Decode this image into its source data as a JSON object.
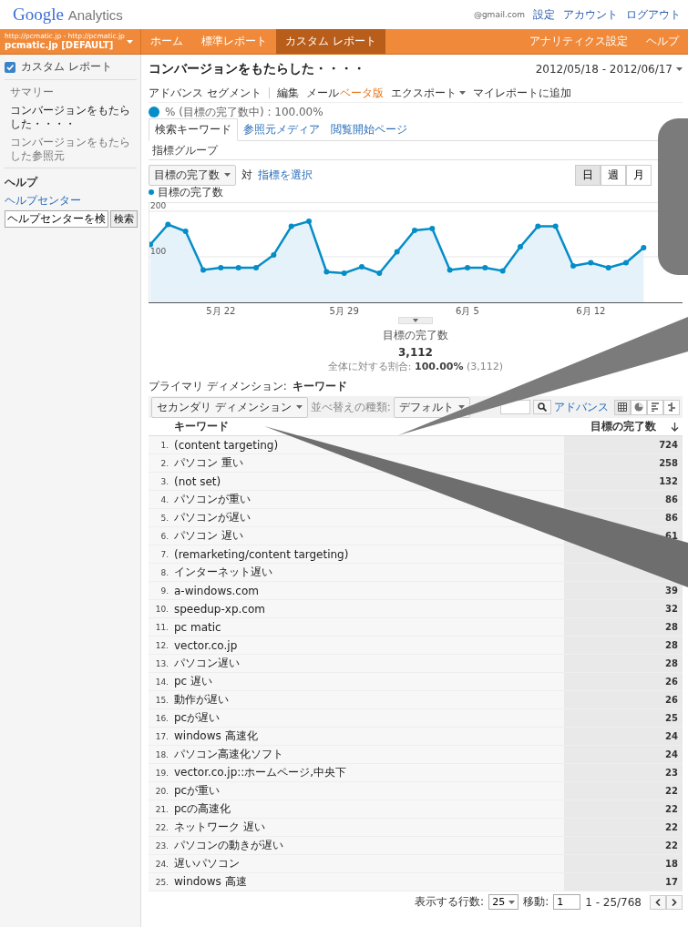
{
  "header": {
    "logo_google": "Google",
    "logo_product": "Analytics",
    "account": "@gmail.com",
    "links": [
      "設定",
      "アカウント",
      "ログアウト"
    ]
  },
  "nav": {
    "profile_url": "http://pcmatic.jp - http://pcmatic.jp",
    "profile_name": "pcmatic.jp [DEFAULT]",
    "tabs": [
      {
        "label": "ホーム",
        "selected": false
      },
      {
        "label": "標準レポート",
        "selected": false
      },
      {
        "label": "カスタム レポート",
        "selected": true
      }
    ],
    "right_tabs": [
      "アナリティクス設定",
      "ヘルプ"
    ]
  },
  "sidebar": {
    "section": "カスタム レポート",
    "items": [
      {
        "label": "サマリー",
        "selected": false
      },
      {
        "label": "コンバージョンをもたらした・・・・",
        "selected": true
      },
      {
        "label": "コンバージョンをもたらした参照元",
        "selected": false
      }
    ],
    "help_title": "ヘルプ",
    "help_link": "ヘルプセンター",
    "search_value": "ヘルプセンターを検",
    "search_button": "検索"
  },
  "report": {
    "title": "コンバージョンをもたらした・・・・",
    "date_range": "2012/05/18 - 2012/06/17",
    "toolbar": [
      {
        "label": "アドバンス セグメント",
        "kind": "text"
      },
      {
        "label": "編集",
        "kind": "text"
      },
      {
        "label": "メール",
        "kind": "text",
        "badge": "ベータ版"
      },
      {
        "label": "エクスポート",
        "kind": "menu"
      },
      {
        "label": "マイレポートに追加",
        "kind": "text"
      }
    ],
    "segment": "% (目標の完了数中) : 100.00%",
    "tabs": [
      {
        "label": "検索キーワード",
        "selected": true
      },
      {
        "label": "参照元メディア",
        "selected": false
      },
      {
        "label": "閲覧開始ページ",
        "selected": false
      }
    ],
    "subtab": "指標グループ",
    "metric_select": "目標の完了数",
    "versus": "対",
    "pick_metric": "指標を選択",
    "granularity": [
      {
        "label": "日",
        "selected": true
      },
      {
        "label": "週",
        "selected": false
      },
      {
        "label": "月",
        "selected": false
      }
    ],
    "chart_data": {
      "type": "area",
      "series": [
        {
          "name": "目標の完了数",
          "color": "#058dc7",
          "values": [
            127,
            171,
            156,
            71,
            76,
            76,
            76,
            104,
            167,
            178,
            67,
            64,
            78,
            64,
            111,
            158,
            162,
            71,
            76,
            76,
            69,
            122,
            167,
            167,
            80,
            87,
            76,
            87,
            120,
            null,
            null
          ]
        }
      ],
      "categories": [
        null,
        null,
        null,
        null,
        "5月 22",
        null,
        null,
        null,
        null,
        null,
        null,
        "5月 29",
        null,
        null,
        null,
        null,
        null,
        null,
        "6月 5",
        null,
        null,
        null,
        null,
        null,
        null,
        "6月 12",
        null,
        null,
        null,
        null,
        null
      ],
      "yticks": [
        100,
        200
      ],
      "ylim": [
        0,
        220
      ]
    },
    "summary": {
      "label": "目標の完了数",
      "value": "3,112",
      "share": "全体に対する割合: **100.00%** (3,112)"
    },
    "primary_label": "プライマリ ディメンション:",
    "primary_value": "キーワード",
    "secondary": "セカンダリ ディメンション",
    "sort_label": "並べ替えの種類:",
    "sort_value": "デフォルト",
    "advanced": "アドバンス",
    "columns": [
      "キーワード",
      "目標の完了数"
    ],
    "rows": [
      {
        "index": "1.",
        "keyword": "(content targeting)",
        "value": "724"
      },
      {
        "index": "2.",
        "keyword": "パソコン 重い",
        "value": "258"
      },
      {
        "index": "3.",
        "keyword": "(not set)",
        "value": "132"
      },
      {
        "index": "4.",
        "keyword": "パソコンが重い",
        "value": "86"
      },
      {
        "index": "5.",
        "keyword": "パソコンが遅い",
        "value": "86"
      },
      {
        "index": "6.",
        "keyword": "パソコン 遅い",
        "value": "61"
      },
      {
        "index": "7.",
        "keyword": "(remarketing/content targeting)"
      },
      {
        "index": "8.",
        "keyword": "インターネット遅い"
      },
      {
        "index": "9.",
        "keyword": "a-windows.com",
        "value": "39"
      },
      {
        "index": "10.",
        "keyword": "speedup-xp.com",
        "value": "32"
      },
      {
        "index": "11.",
        "keyword": "pc matic",
        "value": "28"
      },
      {
        "index": "12.",
        "keyword": "vector.co.jp",
        "value": "28"
      },
      {
        "index": "13.",
        "keyword": "パソコン遅い",
        "value": "28"
      },
      {
        "index": "14.",
        "keyword": "pc 遅い",
        "value": "26"
      },
      {
        "index": "15.",
        "keyword": "動作が遅い",
        "value": "26"
      },
      {
        "index": "16.",
        "keyword": "pcが遅い",
        "value": "25"
      },
      {
        "index": "17.",
        "keyword": "windows 高速化",
        "value": "24"
      },
      {
        "index": "18.",
        "keyword": "パソコン高速化ソフト",
        "value": "24"
      },
      {
        "index": "19.",
        "keyword": "vector.co.jp::ホームページ,中央下",
        "value": "23"
      },
      {
        "index": "20.",
        "keyword": "pcが重い",
        "value": "22"
      },
      {
        "index": "21.",
        "keyword": "pcの高速化",
        "value": "22"
      },
      {
        "index": "22.",
        "keyword": "ネットワーク 遅い",
        "value": "22"
      },
      {
        "index": "23.",
        "keyword": "パソコンの動きが遅い",
        "value": "22"
      },
      {
        "index": "24.",
        "keyword": "遅いパソコン",
        "value": "18"
      },
      {
        "index": "25.",
        "keyword": "windows 高速",
        "value": "17"
      }
    ],
    "pager": {
      "rows_label": "表示する行数:",
      "rows_value": "25",
      "goto_label": "移動:",
      "goto_value": "1",
      "range": "1 - 25/768"
    }
  }
}
